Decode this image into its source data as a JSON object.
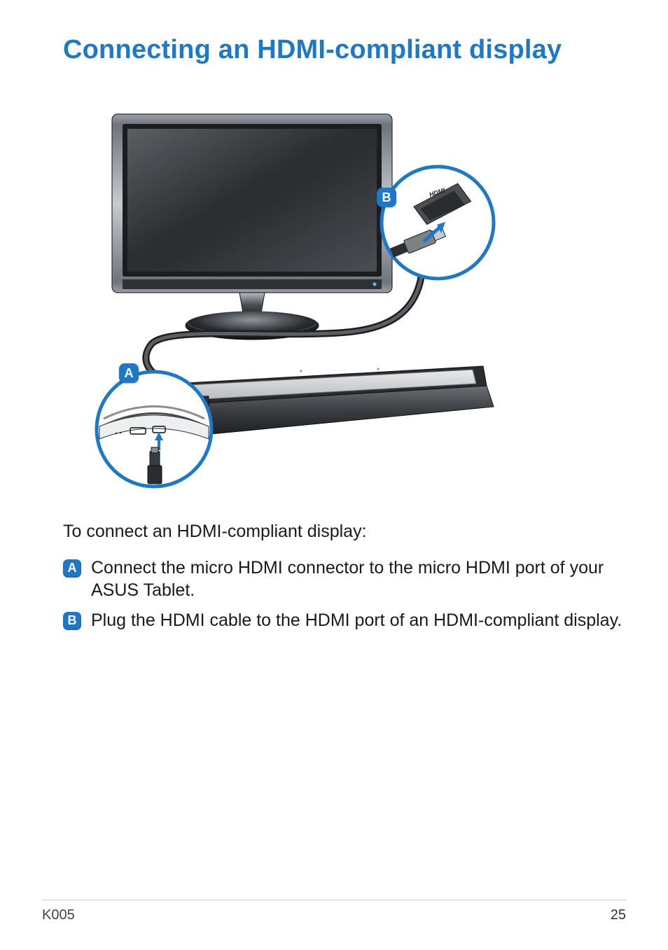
{
  "title": "Connecting an HDMI-compliant display",
  "diagram": {
    "callouts": {
      "a_label": "A",
      "b_label": "B",
      "hdmi_port_text": "HDMI"
    }
  },
  "intro": "To connect an HDMI-compliant display:",
  "steps": [
    {
      "marker": "A",
      "text": "Connect the micro HDMI connector to the micro HDMI port of your ASUS Tablet."
    },
    {
      "marker": "B",
      "text": "Plug the HDMI cable to the HDMI port of an HDMI-compliant display."
    }
  ],
  "footer": {
    "model": "K005",
    "page_number": "25"
  }
}
